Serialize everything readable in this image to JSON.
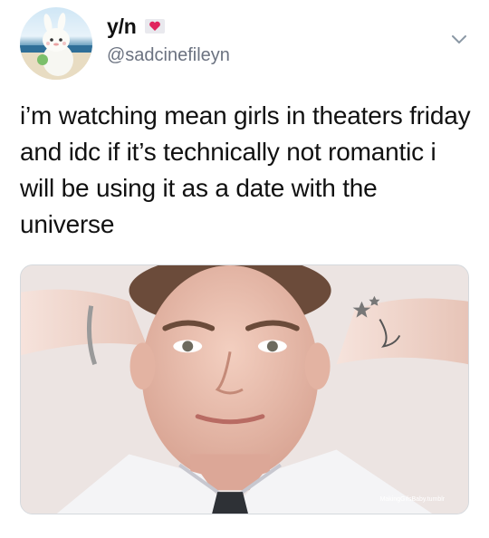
{
  "tweet": {
    "author": {
      "display_name": "y/n",
      "handle": "@sadcinefileyn",
      "badge_icon": "heart-letter-icon",
      "avatar_icon": "cartoon-character-beach-avatar"
    },
    "text": "i’m watching mean girls in theaters friday and idc if it’s technically not romantic i will be using it as a date with the universe",
    "menu_icon": "chevron-down-icon",
    "media": {
      "description_icon": "photo-of-man-hands-behind-head",
      "watermark": "MakingGifsBaby.tumblr"
    }
  },
  "colors": {
    "text": "#111111",
    "secondary_text": "#6b7280",
    "heart": "#e0245e",
    "border": "#d5d9dd"
  }
}
